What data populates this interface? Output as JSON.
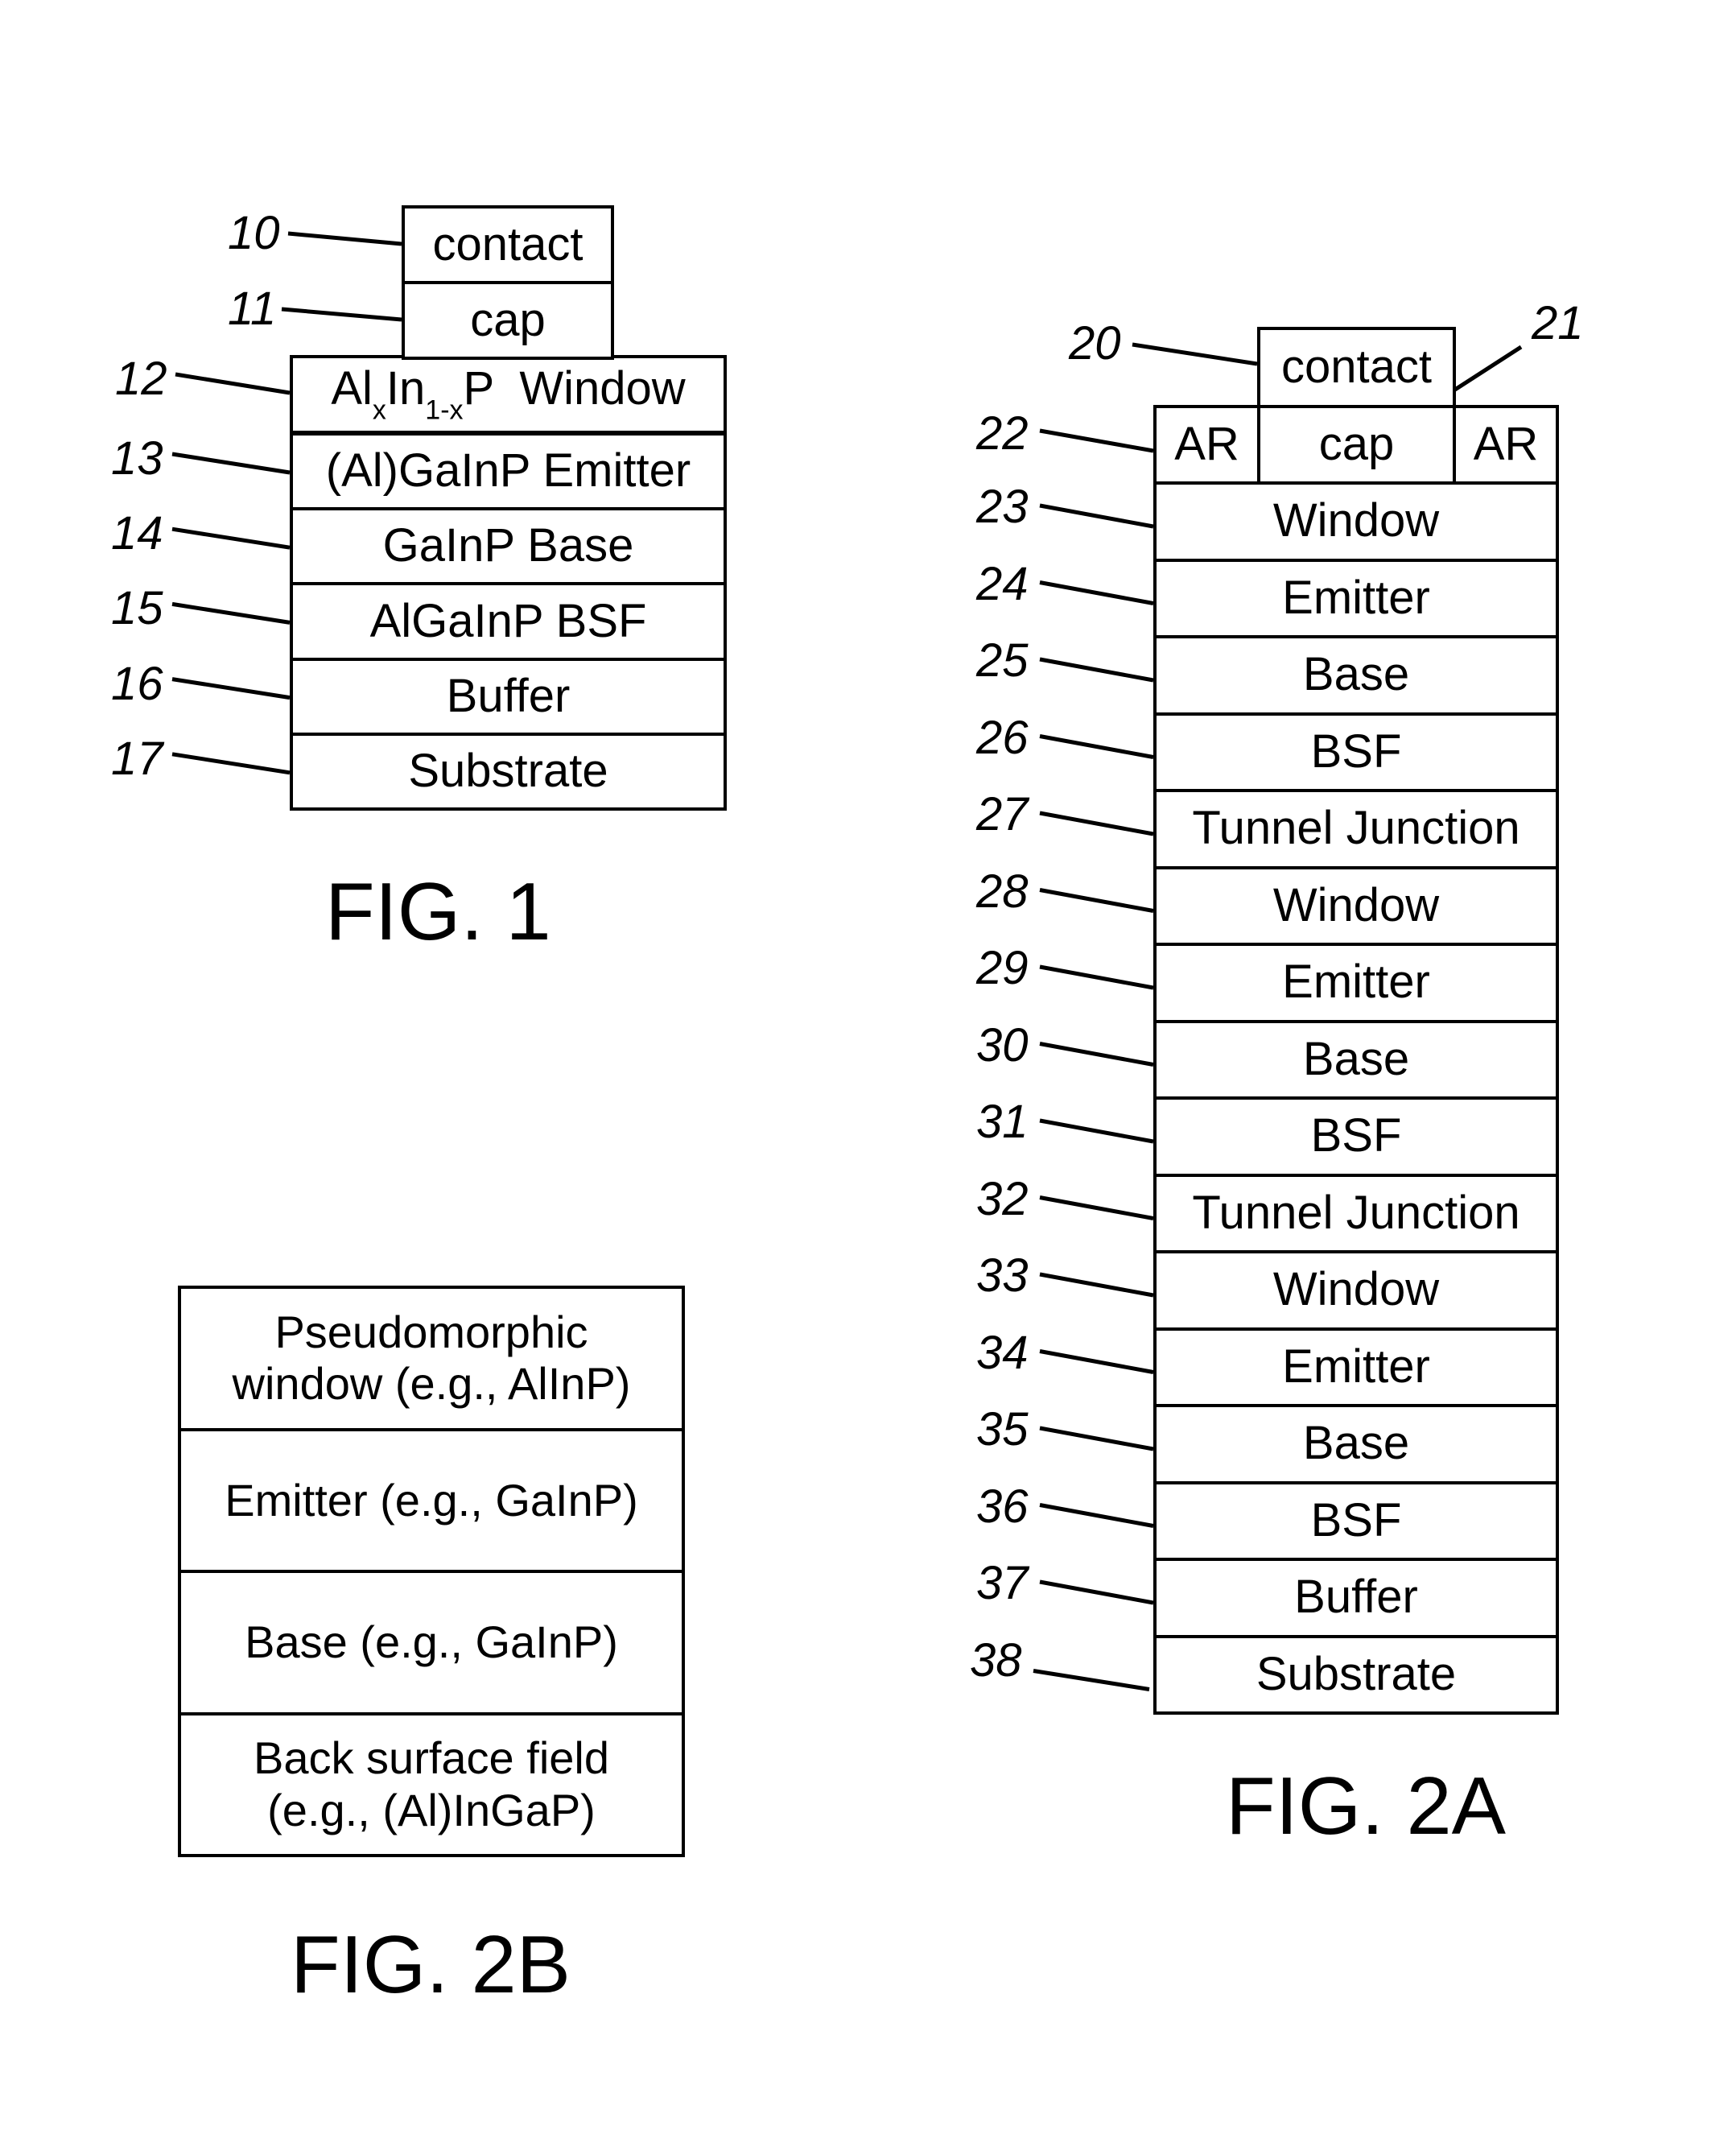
{
  "fig1": {
    "caption": "FIG. 1",
    "top_layers": [
      {
        "ref": "10",
        "label": "contact"
      },
      {
        "ref": "11",
        "label": "cap"
      }
    ],
    "window_layer": {
      "ref": "12",
      "parts": [
        {
          "text": "Al",
          "sub": "x"
        },
        {
          "text": "In",
          "sub": "1-x"
        },
        {
          "text": "P  Window",
          "sub": ""
        }
      ]
    },
    "layers": [
      {
        "ref": "13",
        "label": "(Al)GaInP Emitter"
      },
      {
        "ref": "14",
        "label": "GaInP Base"
      },
      {
        "ref": "15",
        "label": "AlGaInP BSF"
      },
      {
        "ref": "16",
        "label": "Buffer"
      },
      {
        "ref": "17",
        "label": "Substrate"
      }
    ]
  },
  "fig2a": {
    "caption": "FIG. 2A",
    "contact": {
      "ref": "20",
      "label": "contact"
    },
    "cap_row": {
      "cap_ref": "21",
      "ar_ref": "22",
      "ar_left": "AR",
      "cap": "cap",
      "ar_right": "AR"
    },
    "layers": [
      {
        "ref": "23",
        "label": "Window"
      },
      {
        "ref": "24",
        "label": "Emitter"
      },
      {
        "ref": "25",
        "label": "Base"
      },
      {
        "ref": "26",
        "label": "BSF"
      },
      {
        "ref": "27",
        "label": "Tunnel Junction"
      },
      {
        "ref": "28",
        "label": "Window"
      },
      {
        "ref": "29",
        "label": "Emitter"
      },
      {
        "ref": "30",
        "label": "Base"
      },
      {
        "ref": "31",
        "label": "BSF"
      },
      {
        "ref": "32",
        "label": "Tunnel Junction"
      },
      {
        "ref": "33",
        "label": "Window"
      },
      {
        "ref": "34",
        "label": "Emitter"
      },
      {
        "ref": "35",
        "label": "Base"
      },
      {
        "ref": "36",
        "label": "BSF"
      },
      {
        "ref": "37",
        "label": "Buffer"
      },
      {
        "ref": "38",
        "label": "Substrate"
      }
    ]
  },
  "fig2b": {
    "caption": "FIG. 2B",
    "layers": [
      {
        "label": "Pseudomorphic window (e.g., AlInP)"
      },
      {
        "label": "Emitter (e.g., GaInP)"
      },
      {
        "label": "Base (e.g., GaInP)"
      },
      {
        "label": "Back surface field (e.g., (Al)InGaP)"
      }
    ]
  }
}
